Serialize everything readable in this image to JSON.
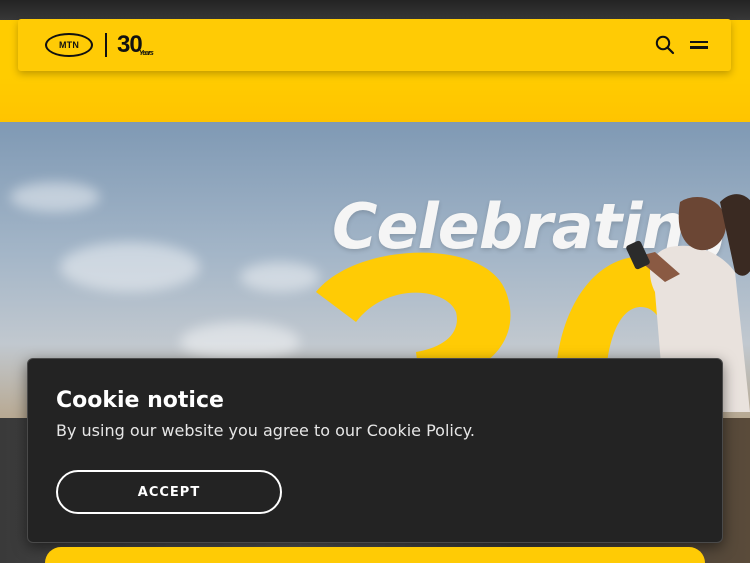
{
  "header": {
    "logo": {
      "brand_text": "MTN",
      "anniversary_number": "30",
      "anniversary_word": "Years"
    },
    "search_icon": "search-icon",
    "menu_icon": "hamburger-menu-icon"
  },
  "hero": {
    "title": "Celebrating"
  },
  "cookie_notice": {
    "title": "Cookie notice",
    "message": "By using our website you agree to our Cookie Policy.",
    "accept_label": "ACCEPT"
  },
  "colors": {
    "brand_yellow": "#ffcb05",
    "modal_background": "#232323",
    "text_dark": "#111111"
  }
}
